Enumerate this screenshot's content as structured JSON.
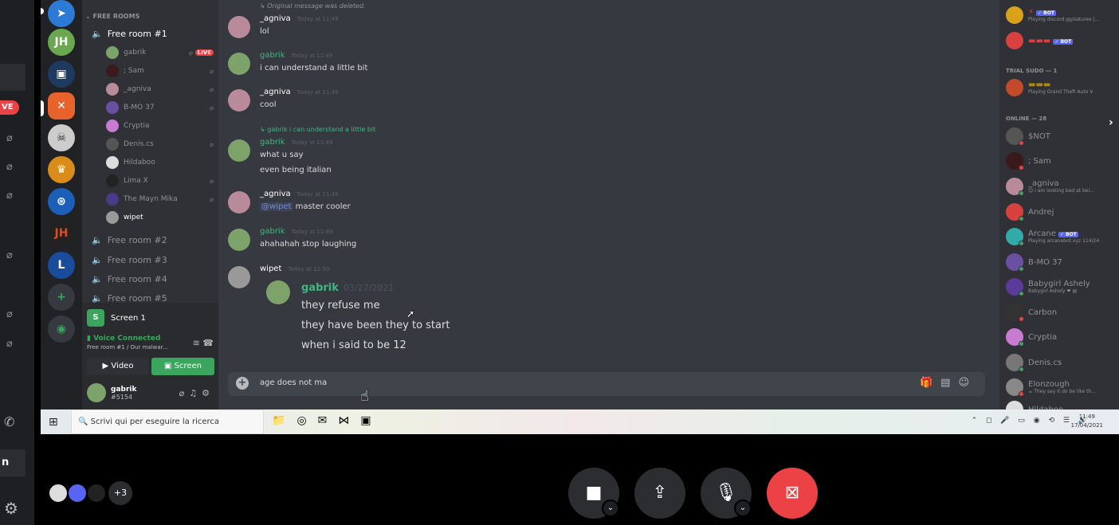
{
  "channels": {
    "category": "FREE ROOMS",
    "rooms": [
      "Free room #1",
      "Free room #2",
      "Free room #3",
      "Free room #4",
      "Free room #5"
    ],
    "voice_users": [
      {
        "name": "gabrik",
        "live": "LIVE",
        "color": "#7da36b"
      },
      {
        "name": "; Sam",
        "color": "#3a1a1a"
      },
      {
        "name": "_agniva",
        "color": "#b98a9a"
      },
      {
        "name": "B-MO 37",
        "color": "#6b4fa3"
      },
      {
        "name": "Cryptia",
        "color": "#c97bd4"
      },
      {
        "name": "Denis.cs",
        "color": "#555"
      },
      {
        "name": "Hildaboo",
        "color": "#ddd"
      },
      {
        "name": "Lima X",
        "color": "#222"
      },
      {
        "name": "The Mayn Mika",
        "color": "#4a3a8a"
      },
      {
        "name": "wipet",
        "color": "#999"
      }
    ]
  },
  "screen_panel": {
    "title": "Screen 1",
    "voice_connected": "Voice Connected",
    "voice_sub": "Free room #1 / Our malwar...",
    "video_label": "Video",
    "screen_label": "Screen",
    "user": "gabrik",
    "tag": "#5154"
  },
  "chat": {
    "deleted_note": "Original message was deleted.",
    "messages": [
      {
        "author": "_agniva",
        "time": "Today at 11:49",
        "lines": [
          "lol"
        ]
      },
      {
        "author": "gabrik",
        "time": "Today at 11:49",
        "lines": [
          "i can understand a little bit"
        ]
      },
      {
        "author": "_agniva",
        "time": "Today at 11:49",
        "lines": [
          "cool"
        ]
      },
      {
        "reply": "gabrik i can understand a little bit",
        "author": "gabrik",
        "time": "Today at 11:49",
        "lines": [
          "what u say",
          "even being italian"
        ]
      },
      {
        "author": "_agniva",
        "time": "Today at 11:49",
        "mention": "@wipet",
        "lines": [
          "master cooler"
        ]
      },
      {
        "author": "gabrik",
        "time": "Today at 11:49",
        "lines": [
          "ahahahah stop laughing"
        ]
      },
      {
        "author": "wipet",
        "time": "Today at 11:50",
        "lines": []
      }
    ],
    "embed": {
      "author": "gabrik",
      "date": "03/27/2021",
      "lines": [
        "they refuse me",
        "they have been they to start",
        "when i said to be 12"
      ]
    },
    "input_text": "age does not ma"
  },
  "members": {
    "trial_cat": "TRIAL SUDO — 1",
    "trial_sub": "Playing Grand Theft Auto V",
    "online_cat": "ONLINE — 28",
    "top_sub": "Playing discord.gg/saturee |...",
    "bot_badge": "✓ BOT",
    "list": [
      {
        "name": "$NOT",
        "color": "#555"
      },
      {
        "name": "; Sam",
        "color": "#3a1a1a"
      },
      {
        "name": "_agniva",
        "sub": "😊 i am looking bad at bei...",
        "color": "#b98a9a"
      },
      {
        "name": "Andrej",
        "color": "#d94040"
      },
      {
        "name": "Arcane",
        "sub": "Playing arcanebot.xyz 114/24",
        "color": "#3aa",
        "bot": true
      },
      {
        "name": "B-MO 37",
        "color": "#6b4fa3"
      },
      {
        "name": "Babygirl Ashely",
        "sub": "Babygirl Ashely ❤ ▤",
        "color": "#5a3a9a"
      },
      {
        "name": "Carbon",
        "color": "#333"
      },
      {
        "name": "Cryptia",
        "color": "#c97bd4"
      },
      {
        "name": "Denis.cs",
        "color": "#777"
      },
      {
        "name": "Elonzough",
        "sub": "☕ They say it do be like th...",
        "color": "#888"
      },
      {
        "name": "Hildaboo",
        "color": "#ddd"
      }
    ]
  },
  "taskbar": {
    "search": "Scrivi qui per eseguire la ricerca",
    "time": "11:49",
    "date": "17/04/2021"
  },
  "call": {
    "more": "+3"
  },
  "outer": {
    "live": "VE",
    "n": "n"
  }
}
